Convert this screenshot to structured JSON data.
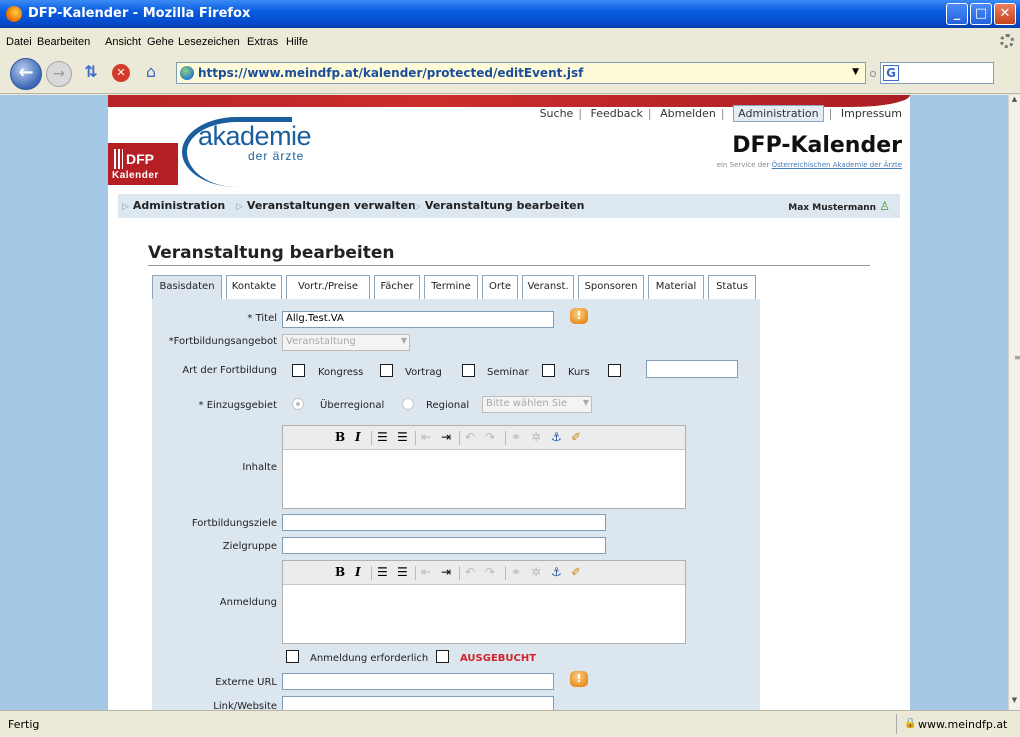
{
  "window": {
    "title": "DFP-Kalender - Mozilla Firefox"
  },
  "menu": [
    "Datei",
    "Bearbeiten",
    "Ansicht",
    "Gehe",
    "Lesezeichen",
    "Extras",
    "Hilfe"
  ],
  "address": {
    "url": "https://www.meindfp.at/kalender/protected/editEvent.jsf"
  },
  "header": {
    "logo_akademie": "akademie",
    "logo_sub": "der ärzte",
    "logo_dfp": "DFP",
    "logo_kalender": "Kalender",
    "nav": [
      "Suche",
      "Feedback",
      "Abmelden",
      "Administration",
      "Impressum"
    ],
    "brand": "DFP-Kalender",
    "service_prefix": "ein Service der ",
    "service_link": "Österreichischen Akademie der Ärzte"
  },
  "breadcrumb": [
    "Administration",
    "Veranstaltungen verwalten",
    "Veranstaltung bearbeiten"
  ],
  "user": "Max Mustermann",
  "page_title": "Veranstaltung bearbeiten",
  "tabs": [
    "Basisdaten",
    "Kontakte",
    "Vortr./Preise",
    "Fächer",
    "Termine",
    "Orte",
    "Veranst.",
    "Sponsoren",
    "Material",
    "Status"
  ],
  "active_tab": "Basisdaten",
  "form": {
    "titel_label": "* Titel",
    "titel_value": "Allg.Test.VA",
    "angebot_label": "*Fortbildungsangebot",
    "angebot_value": "Veranstaltung",
    "art_label": "Art der Fortbildung",
    "art_options": [
      "Kongress",
      "Vortrag",
      "Seminar",
      "Kurs"
    ],
    "einzug_label": "* Einzugsgebiet",
    "einzug_options": [
      "Überregional",
      "Regional"
    ],
    "einzug_select": "Bitte wählen Sie",
    "inhalte_label": "Inhalte",
    "ziele_label": "Fortbildungsziele",
    "zielgruppe_label": "Zielgruppe",
    "anmeldung_label": "Anmeldung",
    "anmeldung_erf": "Anmeldung erforderlich",
    "ausgebucht": "AUSGEBUCHT",
    "url_label": "Externe URL",
    "link_label": "Link/Website"
  },
  "editor_toolbar": [
    "B",
    "I",
    "☰",
    "☰",
    "⇤",
    "⇥",
    "↶",
    "↷",
    "⚭",
    "✲",
    "⚓",
    "✐"
  ],
  "status": {
    "text": "Fertig",
    "host": "www.meindfp.at"
  }
}
